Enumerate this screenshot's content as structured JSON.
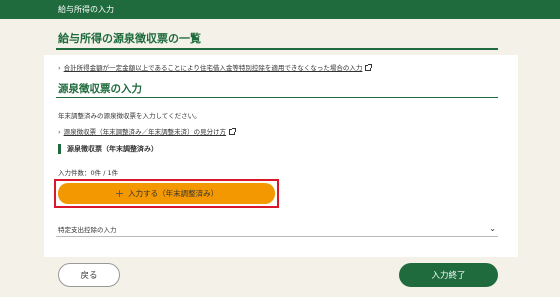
{
  "header": {
    "title": "給与所得の入力"
  },
  "page": {
    "title": "給与所得の源泉徴収票の一覧"
  },
  "links": {
    "housing_loan": "合計所得金額が一定金額以上であることにより住宅借入金等特別控除を適用できなくなった場合の入力",
    "how_to_tell": "源泉徴収票（年末調整済み／年末調整未済）の見分け方"
  },
  "section": {
    "title": "源泉徴収票の入力",
    "description": "年末調整済みの源泉徴収票を入力してください。",
    "subheading": "源泉徴収票（年末調整済み）",
    "count": "入力件数：0件 / 1件",
    "add_button": "入力する（年末調整済み）"
  },
  "accordion": {
    "label": "特定支出控除の入力"
  },
  "footer": {
    "back_label": "戻る",
    "finish_label": "入力終了"
  },
  "icons": {
    "arrow": "›",
    "plus": "+",
    "chevron": "⌄"
  },
  "colors": {
    "brand_green": "#1f6b3d",
    "accent_orange": "#f39800",
    "highlight_red": "#d9162a",
    "background": "#f3f1e8"
  }
}
